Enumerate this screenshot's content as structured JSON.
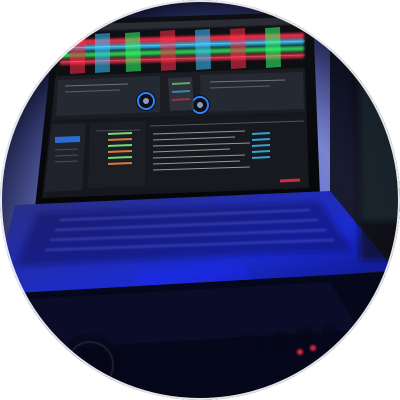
{
  "photo": {
    "subject": "laptop-running-dj-software",
    "crop": "circle",
    "colors": {
      "background": "#ffffff",
      "ambient_dark": "#05071a",
      "blue_light": "#1c2cff",
      "laptop_body": "#2a2f7a",
      "screen_bg": "#1a1c22",
      "waveform_red": "#ff2f4a",
      "waveform_cyan": "#36c6ff",
      "waveform_green": "#34ff6a",
      "panel_gray": "#3a3f48",
      "deck_blue": "#2f80ff",
      "list_green": "#7cff7c",
      "list_orange": "#ff8a3d"
    }
  }
}
